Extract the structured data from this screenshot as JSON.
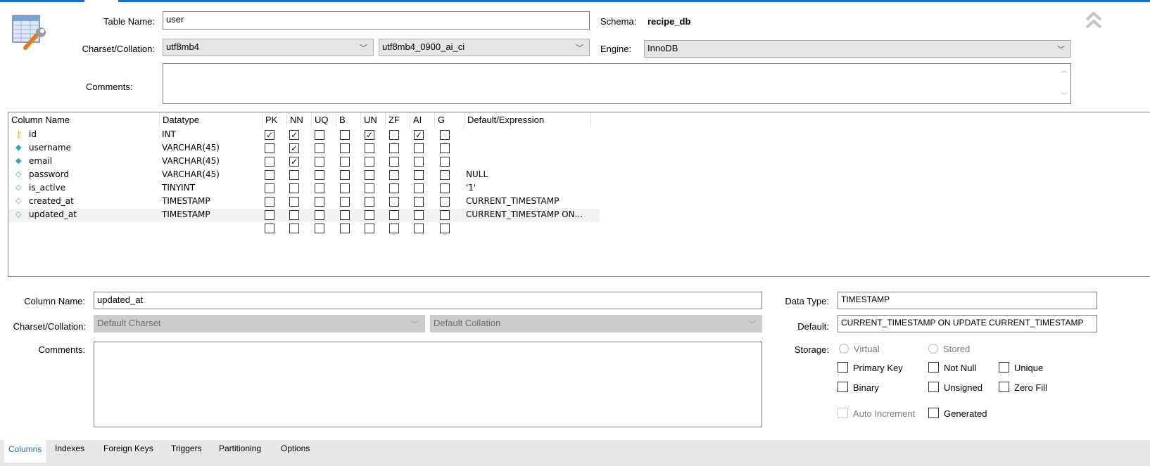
{
  "header": {
    "table_name_label": "Table Name:",
    "table_name": "user",
    "schema_label": "Schema:",
    "schema": "recipe_db",
    "charset_label": "Charset/Collation:",
    "charset": "utf8mb4",
    "collation": "utf8mb4_0900_ai_ci",
    "engine_label": "Engine:",
    "engine": "InnoDB",
    "comments_label": "Comments:",
    "comments": ""
  },
  "grid": {
    "headers": [
      "Column Name",
      "Datatype",
      "PK",
      "NN",
      "UQ",
      "B",
      "UN",
      "ZF",
      "AI",
      "G",
      "Default/Expression"
    ],
    "rows": [
      {
        "name": "id",
        "icon": "key-icon",
        "type": "INT",
        "flags": [
          true,
          true,
          false,
          false,
          true,
          false,
          true,
          false
        ],
        "default": ""
      },
      {
        "name": "username",
        "icon": "column-filled-icon",
        "type": "VARCHAR(45)",
        "flags": [
          false,
          true,
          false,
          false,
          false,
          false,
          false,
          false
        ],
        "default": ""
      },
      {
        "name": "email",
        "icon": "column-filled-icon",
        "type": "VARCHAR(45)",
        "flags": [
          false,
          true,
          false,
          false,
          false,
          false,
          false,
          false
        ],
        "default": ""
      },
      {
        "name": "password",
        "icon": "column-empty-icon",
        "type": "VARCHAR(45)",
        "flags": [
          false,
          false,
          false,
          false,
          false,
          false,
          false,
          false
        ],
        "default": "NULL"
      },
      {
        "name": "is_active",
        "icon": "column-empty-icon",
        "type": "TINYINT",
        "flags": [
          false,
          false,
          false,
          false,
          false,
          false,
          false,
          false
        ],
        "default": "'1'"
      },
      {
        "name": "created_at",
        "icon": "column-empty-icon",
        "type": "TIMESTAMP",
        "flags": [
          false,
          false,
          false,
          false,
          false,
          false,
          false,
          false
        ],
        "default": "CURRENT_TIMESTAMP"
      },
      {
        "name": "updated_at",
        "icon": "column-empty-icon",
        "type": "TIMESTAMP",
        "flags": [
          false,
          false,
          false,
          false,
          false,
          false,
          false,
          false
        ],
        "default": "CURRENT_TIMESTAMP ON..."
      },
      {
        "name": "",
        "icon": "",
        "type": "",
        "flags": [
          false,
          false,
          false,
          false,
          false,
          false,
          false,
          false
        ],
        "default": ""
      }
    ]
  },
  "detail": {
    "column_name_label": "Column Name:",
    "column_name": "updated_at",
    "charset_label": "Charset/Collation:",
    "charset": "Default Charset",
    "collation": "Default Collation",
    "comments_label": "Comments:",
    "comments": "",
    "datatype_label": "Data Type:",
    "datatype": "TIMESTAMP",
    "default_label": "Default:",
    "default": "CURRENT_TIMESTAMP ON UPDATE CURRENT_TIMESTAMP",
    "storage_label": "Storage:",
    "virtual_label": "Virtual",
    "stored_label": "Stored",
    "primary_key_label": "Primary Key",
    "not_null_label": "Not Null",
    "unique_label": "Unique",
    "binary_label": "Binary",
    "unsigned_label": "Unsigned",
    "zero_fill_label": "Zero Fill",
    "auto_increment_label": "Auto Increment",
    "generated_label": "Generated"
  },
  "bottom_tabs": [
    "Columns",
    "Indexes",
    "Foreign Keys",
    "Triggers",
    "Partitioning",
    "Options"
  ],
  "colors": {
    "accent": "#1d6fc9",
    "key": "#e8b326",
    "column_icon": "#3c9ac6"
  }
}
